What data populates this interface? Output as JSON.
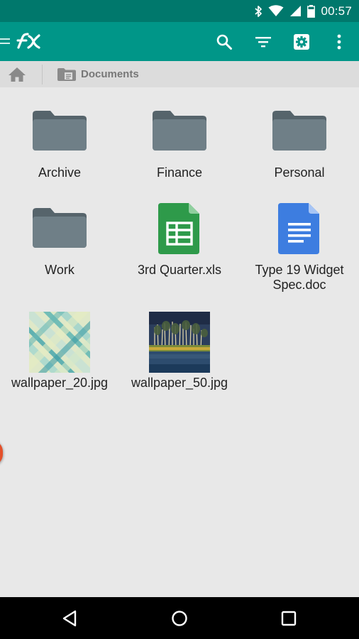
{
  "status_bar": {
    "time": "00:57",
    "icons": [
      "bluetooth-icon",
      "wifi-icon",
      "cell-signal-icon",
      "battery-icon"
    ]
  },
  "app_bar": {
    "logo_icon": "fx-logo-icon",
    "actions": [
      "search-icon",
      "sort-filter-icon",
      "settings-icon",
      "more-vert-icon"
    ],
    "background": "#009688"
  },
  "breadcrumb": {
    "home_icon": "home-icon",
    "current_folder": "Documents"
  },
  "files": [
    {
      "name": "Archive",
      "type": "folder"
    },
    {
      "name": "Finance",
      "type": "folder"
    },
    {
      "name": "Personal",
      "type": "folder"
    },
    {
      "name": "Work",
      "type": "folder"
    },
    {
      "name": "3rd Quarter.xls",
      "type": "spreadsheet"
    },
    {
      "name": "Type 19 Widget Spec.doc",
      "type": "document"
    },
    {
      "name": "wallpaper_20.jpg",
      "type": "image"
    },
    {
      "name": "wallpaper_50.jpg",
      "type": "image"
    }
  ],
  "nav_bar": {
    "buttons": [
      "back-icon",
      "home-circle-icon",
      "recents-icon"
    ]
  },
  "colors": {
    "status_bar": "#00786c",
    "accent": "#009688",
    "folder": "#6f7f87",
    "spreadsheet": "#2e9a4a",
    "document": "#3d7de0"
  }
}
